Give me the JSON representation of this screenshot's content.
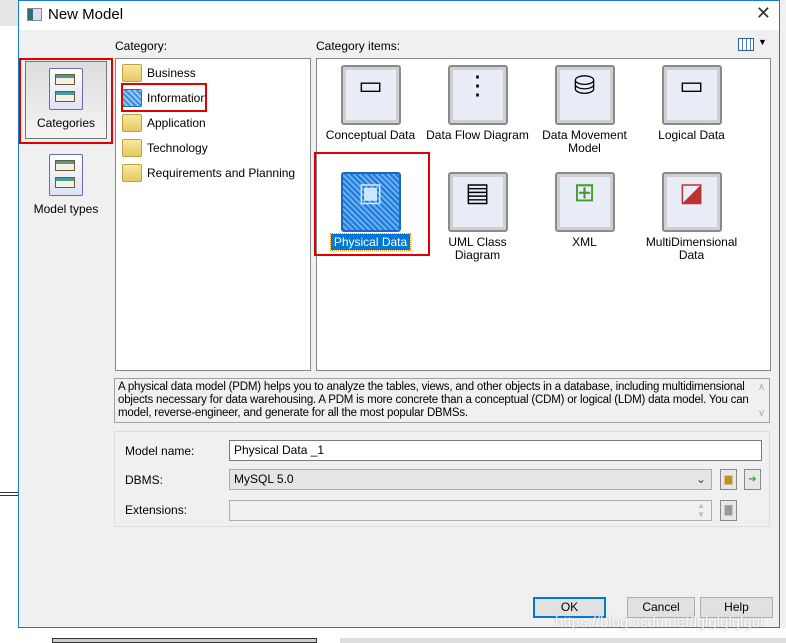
{
  "window": {
    "title": "New Model"
  },
  "nav": [
    {
      "label": "Categories",
      "selected": true
    },
    {
      "label": "Model types",
      "selected": false
    }
  ],
  "category": {
    "label": "Category:",
    "items": [
      {
        "label": "Business",
        "icon": "folder-icon"
      },
      {
        "label": "Information",
        "icon": "folder-selected-icon",
        "selected": true
      },
      {
        "label": "Application",
        "icon": "folder-icon"
      },
      {
        "label": "Technology",
        "icon": "folder-icon"
      },
      {
        "label": "Requirements and Planning",
        "icon": "folder-icon"
      }
    ]
  },
  "category_items": {
    "label": "Category items:",
    "items": [
      {
        "label": "Conceptual Data",
        "glyph": "▭"
      },
      {
        "label": "Data Flow Diagram",
        "glyph": "⋮"
      },
      {
        "label": "Data Movement Model",
        "glyph": "⛁"
      },
      {
        "label": "Logical Data",
        "glyph": "▭"
      },
      {
        "label": "Physical Data",
        "glyph": "▣",
        "selected": true
      },
      {
        "label": "UML Class Diagram",
        "glyph": "▤"
      },
      {
        "label": "XML",
        "glyph": "⊞"
      },
      {
        "label": "MultiDimensional Data",
        "glyph": "◪"
      }
    ]
  },
  "description": "A physical data model (PDM) helps you to analyze the tables, views, and other objects in a database, including multidimensional objects necessary for data warehousing. A PDM is more concrete than a conceptual (CDM) or logical (LDM) data model. You can model, reverse-engineer, and generate for all the most popular DBMSs.",
  "form": {
    "model_name_label": "Model name:",
    "model_name_value": "Physical Data _1",
    "dbms_label": "DBMS:",
    "dbms_value": "MySQL 5.0",
    "extensions_label": "Extensions:",
    "extensions_value": ""
  },
  "buttons": {
    "ok": "OK",
    "cancel": "Cancel",
    "help": "Help"
  },
  "watermark": "https://blog.csdn.net/lglglglglgui",
  "colors": {
    "accent": "#0078d7",
    "highlight": "#e00000"
  }
}
